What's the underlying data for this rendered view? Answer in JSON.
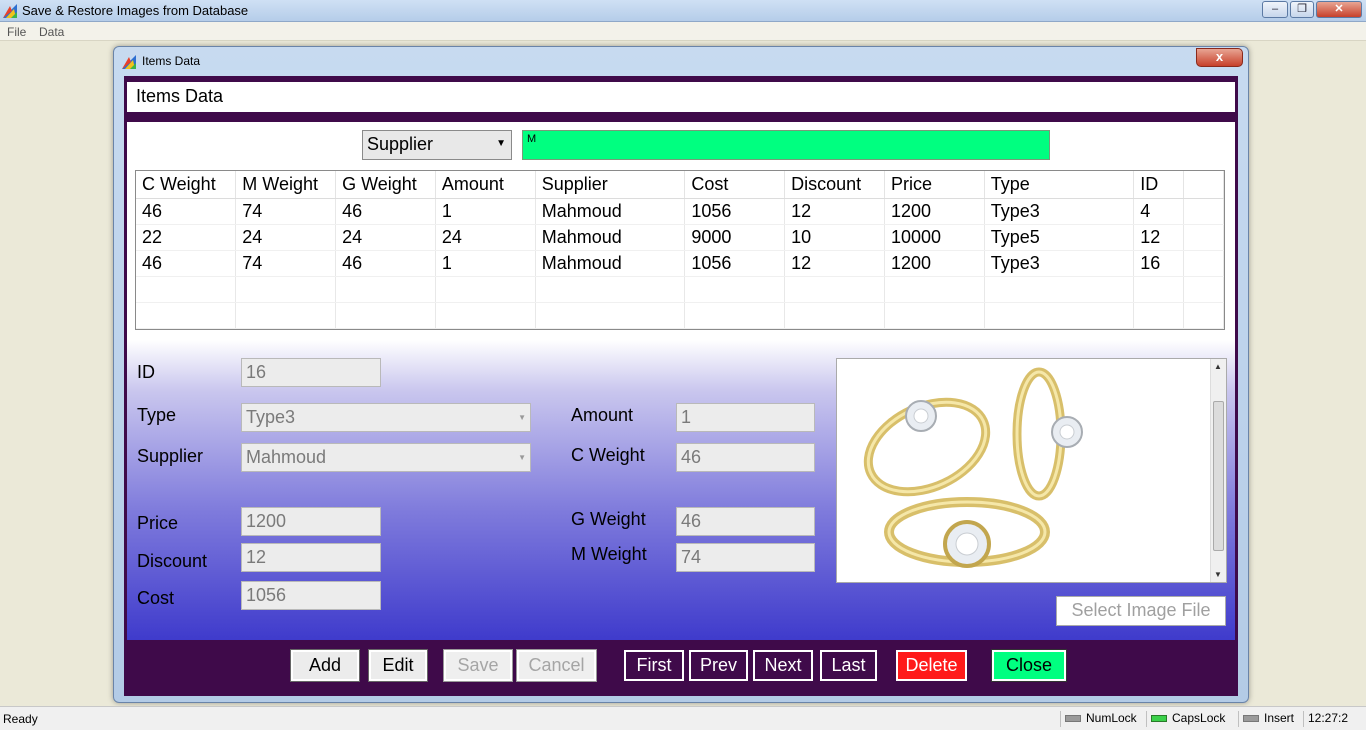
{
  "app": {
    "title": "Save & Restore Images from Database",
    "menu": [
      "File",
      "Data"
    ]
  },
  "dialog": {
    "title": "Items Data",
    "header": "Items Data",
    "close_glyph": "x"
  },
  "search": {
    "field_select": "Supplier",
    "value": "M"
  },
  "grid": {
    "columns": [
      "C Weight",
      "M Weight",
      "G Weight",
      "Amount",
      "Supplier",
      "Cost",
      "Discount",
      "Price",
      "Type",
      "ID"
    ],
    "rows": [
      [
        "46",
        "74",
        "46",
        "1",
        "Mahmoud",
        "1056",
        "12",
        "1200",
        "Type3",
        "4"
      ],
      [
        "22",
        "24",
        "24",
        "24",
        "Mahmoud",
        "9000",
        "10",
        "10000",
        "Type5",
        "12"
      ],
      [
        "46",
        "74",
        "46",
        "1",
        "Mahmoud",
        "1056",
        "12",
        "1200",
        "Type3",
        "16"
      ]
    ]
  },
  "form": {
    "id_label": "ID",
    "id_value": "16",
    "type_label": "Type",
    "type_value": "Type3",
    "supplier_label": "Supplier",
    "supplier_value": "Mahmoud",
    "price_label": "Price",
    "price_value": "1200",
    "discount_label": "Discount",
    "discount_value": "12",
    "cost_label": "Cost",
    "cost_value": "1056",
    "amount_label": "Amount",
    "amount_value": "1",
    "cweight_label": "C Weight",
    "cweight_value": "46",
    "gweight_label": "G Weight",
    "gweight_value": "46",
    "mweight_label": "M Weight",
    "mweight_value": "74"
  },
  "image_panel": {
    "select_button": "Select Image File"
  },
  "buttons": {
    "add": "Add",
    "edit": "Edit",
    "save": "Save",
    "cancel": "Cancel",
    "first": "First",
    "prev": "Prev",
    "next": "Next",
    "last": "Last",
    "delete": "Delete",
    "close": "Close"
  },
  "status": {
    "text": "Ready",
    "numlock": "NumLock",
    "capslock": "CapsLock",
    "insert": "Insert",
    "time": "12:27:2"
  },
  "colors": {
    "dialog_bg": "#3f0a4a",
    "search_bg": "#00ff80",
    "delete_bg": "#ff1a1a",
    "close_bg": "#00ff80"
  }
}
